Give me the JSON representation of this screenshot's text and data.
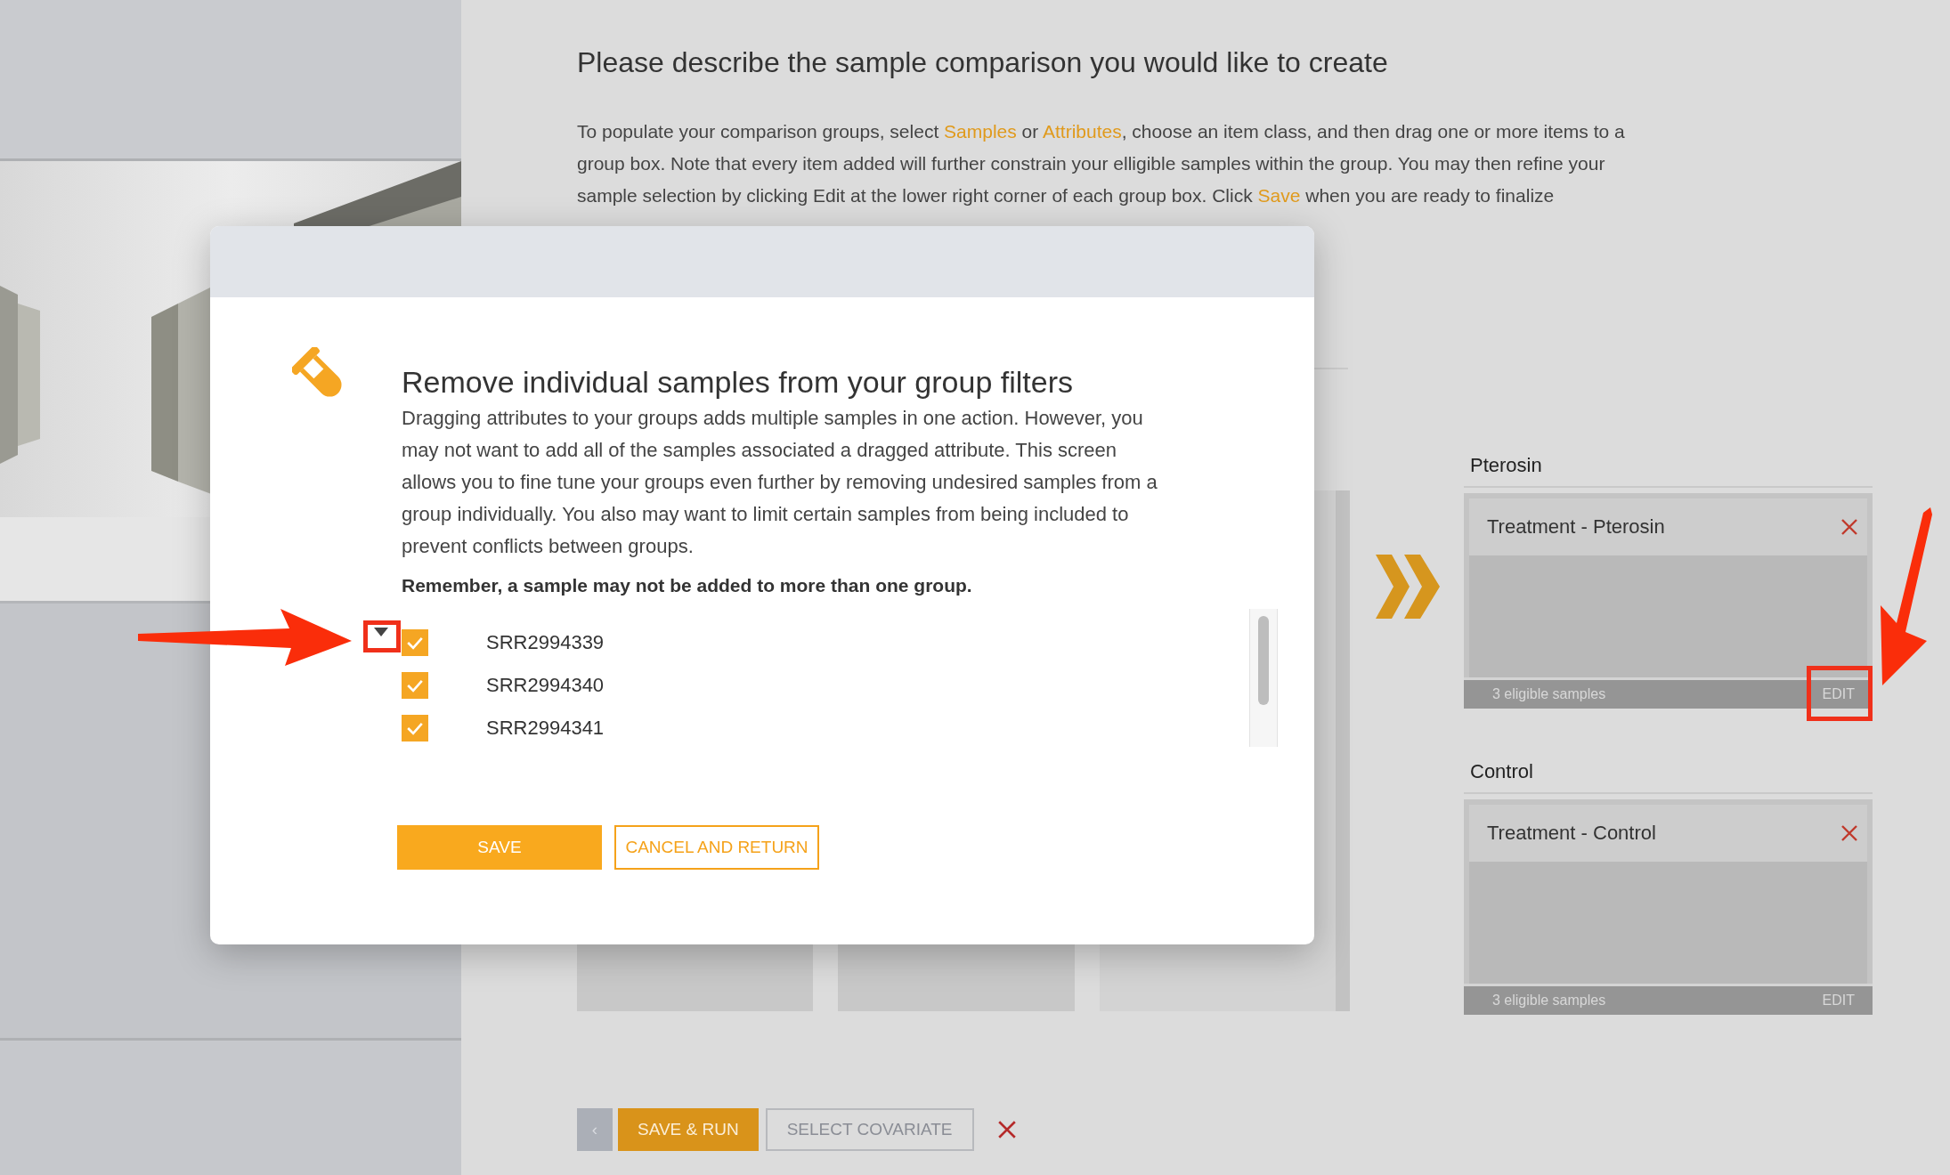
{
  "page": {
    "title": "Please describe the sample comparison you would like to create",
    "intro": [
      {
        "kind": "text",
        "text": "To populate your comparison groups, select "
      },
      {
        "kind": "link",
        "text": "Samples"
      },
      {
        "kind": "text",
        "text": " or "
      },
      {
        "kind": "link",
        "text": "Attributes"
      },
      {
        "kind": "text",
        "text": ", choose an item class, and then drag one or more items to a group box. Note that every item added will further constrain your elligible samples within the group. You may then refine your sample selection by clicking Edit at the lower right corner of each group box. Click "
      },
      {
        "kind": "link",
        "text": "Save"
      },
      {
        "kind": "text",
        "text": " when you are ready to finalize"
      }
    ]
  },
  "groups": [
    {
      "name": "Pterosin",
      "item": "Treatment - Pterosin",
      "count": "3 eligible samples",
      "edit": "EDIT",
      "annotated": true
    },
    {
      "name": "Control",
      "item": "Treatment - Control",
      "count": "3 eligible samples",
      "edit": "EDIT",
      "annotated": false
    }
  ],
  "footer_buttons": [
    {
      "kind": "back",
      "label": "‹"
    },
    {
      "kind": "primary",
      "label": "SAVE & RUN"
    },
    {
      "kind": "disabled",
      "label": "SELECT COVARIATE"
    }
  ],
  "modal": {
    "heading": "Remove individual samples from your group filters",
    "description": "Dragging attributes to your groups adds multiple samples in one action. However, you may not want to add all of the samples associated a dragged attribute. This screen allows you to fine tune your groups even further by removing undesired samples from a group individually. You also may want to limit certain samples from being included to prevent conflicts between groups.",
    "note": "Remember, a sample may not be added to more than one group.",
    "samples": [
      {
        "id": "SRR2994339",
        "checked": true
      },
      {
        "id": "SRR2994340",
        "checked": true
      },
      {
        "id": "SRR2994341",
        "checked": true
      }
    ],
    "buttons": [
      {
        "kind": "primary",
        "label": "SAVE"
      },
      {
        "kind": "outline",
        "label": "CANCEL AND RETURN"
      }
    ]
  }
}
